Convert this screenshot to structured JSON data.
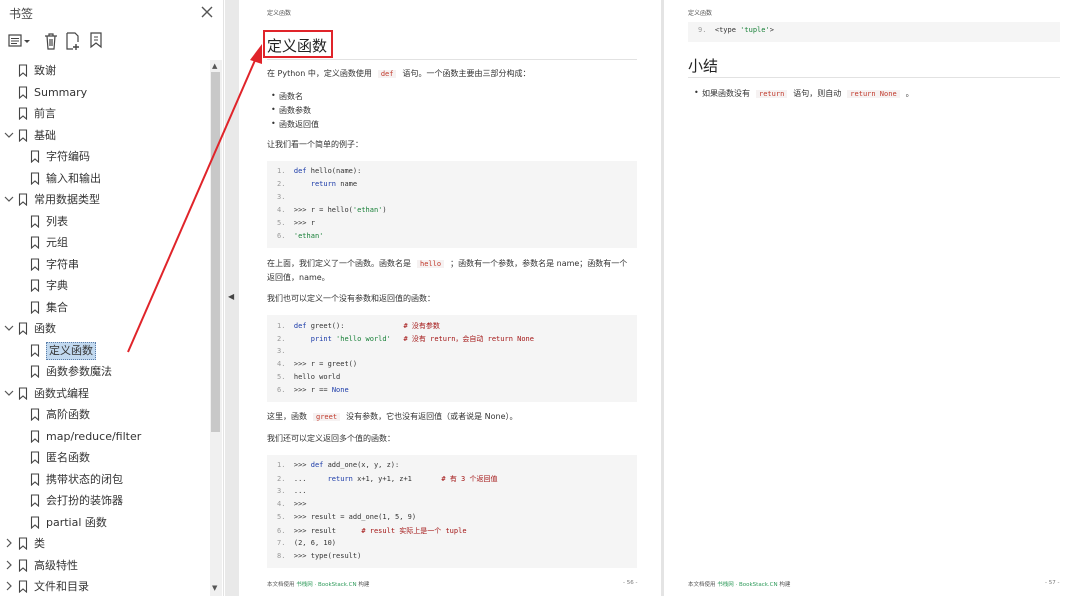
{
  "sidebar": {
    "title": "书签",
    "items": [
      {
        "label": "致谢",
        "indent": 0,
        "expander": "none"
      },
      {
        "label": "Summary",
        "indent": 0,
        "expander": "none"
      },
      {
        "label": "前言",
        "indent": 0,
        "expander": "none"
      },
      {
        "label": "基础",
        "indent": 0,
        "expander": "expanded"
      },
      {
        "label": "字符编码",
        "indent": 1,
        "expander": "none"
      },
      {
        "label": "输入和输出",
        "indent": 1,
        "expander": "none"
      },
      {
        "label": "常用数据类型",
        "indent": 0,
        "expander": "expanded"
      },
      {
        "label": "列表",
        "indent": 1,
        "expander": "none"
      },
      {
        "label": "元组",
        "indent": 1,
        "expander": "none"
      },
      {
        "label": "字符串",
        "indent": 1,
        "expander": "none"
      },
      {
        "label": "字典",
        "indent": 1,
        "expander": "none"
      },
      {
        "label": "集合",
        "indent": 1,
        "expander": "none"
      },
      {
        "label": "函数",
        "indent": 0,
        "expander": "expanded"
      },
      {
        "label": "定义函数",
        "indent": 1,
        "expander": "none",
        "selected": true
      },
      {
        "label": "函数参数魔法",
        "indent": 1,
        "expander": "none"
      },
      {
        "label": "函数式编程",
        "indent": 0,
        "expander": "expanded"
      },
      {
        "label": "高阶函数",
        "indent": 1,
        "expander": "none"
      },
      {
        "label": "map/reduce/filter",
        "indent": 1,
        "expander": "none"
      },
      {
        "label": "匿名函数",
        "indent": 1,
        "expander": "none"
      },
      {
        "label": "携带状态的闭包",
        "indent": 1,
        "expander": "none"
      },
      {
        "label": "会打扮的装饰器",
        "indent": 1,
        "expander": "none"
      },
      {
        "label": "partial 函数",
        "indent": 1,
        "expander": "none"
      },
      {
        "label": "类",
        "indent": 0,
        "expander": "collapsed"
      },
      {
        "label": "高级特性",
        "indent": 0,
        "expander": "collapsed"
      },
      {
        "label": "文件和目录",
        "indent": 0,
        "expander": "collapsed"
      }
    ]
  },
  "page1": {
    "running_head": "定义函数",
    "title": "定义函数",
    "intro": {
      "before": "在 Python 中，定义函数使用",
      "code": "def",
      "after": "语句。一个函数主要由三部分构成："
    },
    "bullets": [
      "函数名",
      "函数参数",
      "函数返回值"
    ],
    "example_intro": "让我们看一个简单的例子：",
    "code1": [
      {
        "n": "1.",
        "parts": [
          [
            "kw",
            "def "
          ],
          [
            "",
            "hello(name):"
          ]
        ]
      },
      {
        "n": "2.",
        "parts": [
          [
            "",
            "    "
          ],
          [
            "kw",
            "return"
          ],
          [
            "",
            " name"
          ]
        ]
      },
      {
        "n": "3.",
        "parts": []
      },
      {
        "n": "4.",
        "parts": [
          [
            "",
            ">>> r = hello("
          ],
          [
            "st",
            "'ethan'"
          ],
          [
            "",
            ")"
          ]
        ]
      },
      {
        "n": "5.",
        "parts": [
          [
            "",
            ">>> r"
          ]
        ]
      },
      {
        "n": "6.",
        "parts": [
          [
            "st",
            "'ethan'"
          ]
        ]
      }
    ],
    "para2": {
      "before": "在上面，我们定义了一个函数。函数名是",
      "code": "hello",
      "after": "；函数有一个参数，参数名是 name；函数有一个",
      "line2": "返回值，name。"
    },
    "para3": "我们也可以定义一个没有参数和返回值的函数：",
    "code2": [
      {
        "n": "1.",
        "parts": [
          [
            "kw",
            "def "
          ],
          [
            "",
            "greet():              "
          ],
          [
            "cm",
            "# 没有参数"
          ]
        ]
      },
      {
        "n": "2.",
        "parts": [
          [
            "",
            "    "
          ],
          [
            "kw",
            "print "
          ],
          [
            "st",
            "'hello world'"
          ],
          [
            "",
            "   "
          ],
          [
            "cm",
            "# 没有 return，会自动 return None"
          ]
        ]
      },
      {
        "n": "3.",
        "parts": []
      },
      {
        "n": "4.",
        "parts": [
          [
            "",
            ">>> r = greet()"
          ]
        ]
      },
      {
        "n": "5.",
        "parts": [
          [
            "",
            "hello world"
          ]
        ]
      },
      {
        "n": "6.",
        "parts": [
          [
            "",
            ">>> r == "
          ],
          [
            "nm",
            "None"
          ]
        ]
      }
    ],
    "para4": {
      "before": "这里，函数",
      "code": "greet",
      "after": "没有参数，它也没有返回值（或者说是 None）。"
    },
    "para5": "我们还可以定义返回多个值的函数：",
    "code3": [
      {
        "n": "1.",
        "parts": [
          [
            "",
            ">>> "
          ],
          [
            "kw",
            "def "
          ],
          [
            "",
            "add_one(x, y, z):"
          ]
        ]
      },
      {
        "n": "2.",
        "parts": [
          [
            "",
            "...     "
          ],
          [
            "kw",
            "return"
          ],
          [
            "",
            " x+1, y+1, z+1       "
          ],
          [
            "cm",
            "# 有 3 个返回值"
          ]
        ]
      },
      {
        "n": "3.",
        "parts": [
          [
            "",
            "..."
          ]
        ]
      },
      {
        "n": "4.",
        "parts": [
          [
            "",
            ">>>"
          ]
        ]
      },
      {
        "n": "5.",
        "parts": [
          [
            "",
            ">>> result = add_one(1, 5, 9)"
          ]
        ]
      },
      {
        "n": "6.",
        "parts": [
          [
            "",
            ">>> result      "
          ],
          [
            "cm",
            "# result 实际上是一个 tuple"
          ]
        ]
      },
      {
        "n": "7.",
        "parts": [
          [
            "",
            "(2, 6, 10)"
          ]
        ]
      },
      {
        "n": "8.",
        "parts": [
          [
            "",
            ">>> type(result)"
          ]
        ]
      }
    ],
    "footer": {
      "prefix": "本文档使用 ",
      "brand": "书栈网 · BookStack.CN",
      "suffix": " 构建",
      "page": "- 56 -"
    }
  },
  "page2": {
    "running_head": "定义函数",
    "code_top": [
      {
        "n": "9.",
        "parts": [
          [
            "",
            "<type "
          ],
          [
            "st",
            "'tuple'"
          ],
          [
            "",
            ">"
          ]
        ]
      }
    ],
    "section_title": "小结",
    "bullet": {
      "before": "如果函数没有",
      "code1": "return",
      "middle": "语句，则自动",
      "code2": "return None",
      "after": "。"
    },
    "footer": {
      "prefix": "本文档使用 ",
      "brand": "书栈网 · BookStack.CN",
      "suffix": " 构建",
      "page": "- 57 -"
    }
  },
  "colors": {
    "highlight": "#e0242a",
    "selection": "#c2d9ef"
  }
}
